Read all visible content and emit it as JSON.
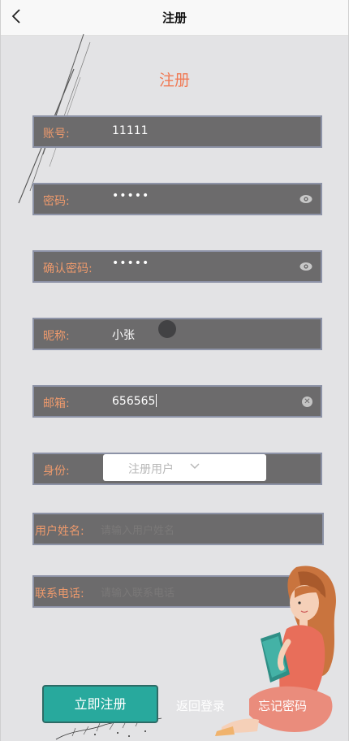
{
  "navbar": {
    "title": "注册"
  },
  "page_title": "注册",
  "form": {
    "account": {
      "label": "账号:",
      "value": "11111"
    },
    "password": {
      "label": "密码:",
      "value": "•••••"
    },
    "confirm_password": {
      "label": "确认密码:",
      "value": "•••••"
    },
    "nickname": {
      "label": "昵称:",
      "value": "小张"
    },
    "email": {
      "label": "邮箱:",
      "value": "656565"
    },
    "identity": {
      "label": "身份:",
      "selected": "注册用户"
    },
    "username": {
      "label": "用户姓名:",
      "placeholder": "请输入用户姓名"
    },
    "phone": {
      "label": "联系电话:",
      "placeholder": "请输入联系电话"
    }
  },
  "actions": {
    "register_label": "立即注册",
    "back_login_label": "返回登录",
    "forgot_password_label": "忘记密码"
  },
  "colors": {
    "background": "#e3e3e5",
    "input_bg": "#6c6b6c",
    "label": "#ee9a6c",
    "title": "#f07a55",
    "button": "#28a99d"
  }
}
